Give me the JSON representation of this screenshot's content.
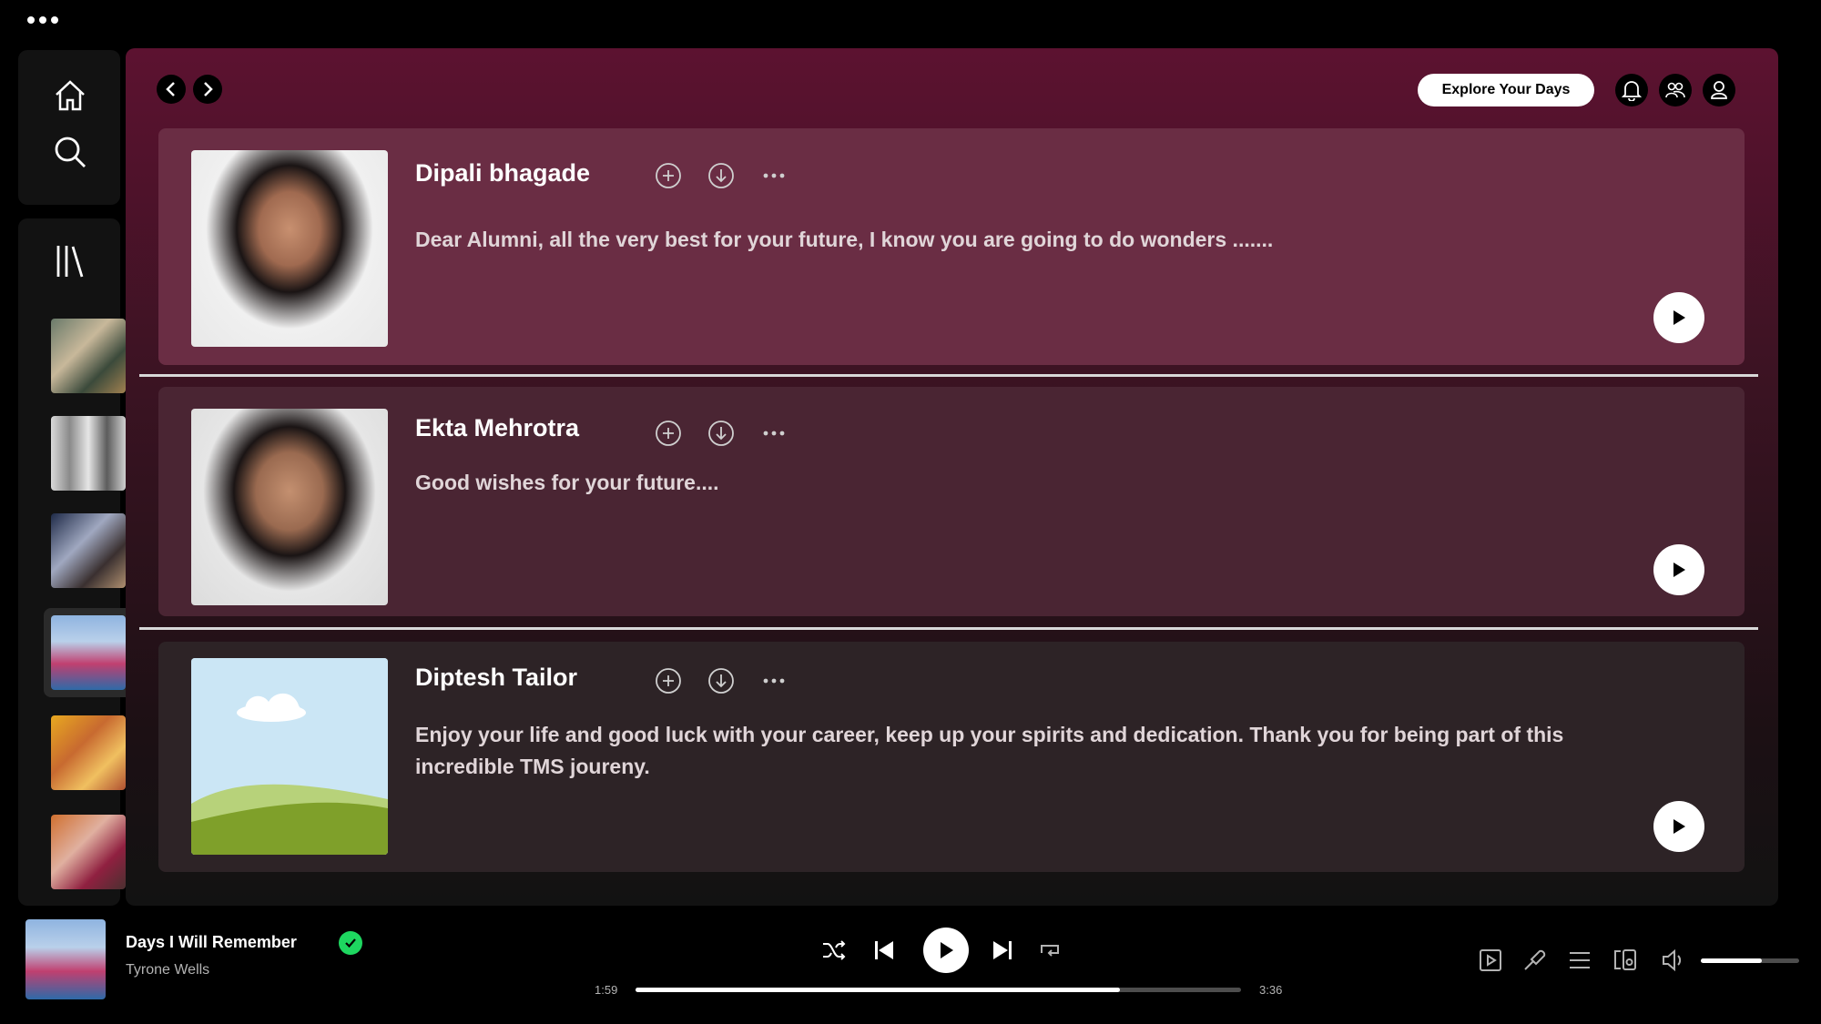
{
  "topbar": {
    "explore_label": "Explore Your Days"
  },
  "cards": [
    {
      "name": "Dipali bhagade",
      "message": "Dear Alumni, all the very best for your future, I know you are going to do wonders ......."
    },
    {
      "name": "Ekta Mehrotra",
      "message": "Good wishes for your future...."
    },
    {
      "name": "Diptesh Tailor",
      "message": "Enjoy your life and good luck with your career, keep up your spirits and dedication. Thank you for being part of this incredible TMS joureny."
    }
  ],
  "player": {
    "title": "Days I Will Remember",
    "artist": "Tyrone Wells",
    "elapsed": "1:59",
    "duration": "3:36",
    "progress_fraction": 0.8,
    "volume_fraction": 0.62
  },
  "colors": {
    "accent": "#1ed760",
    "card_1": "#6a2d44",
    "card_2": "#4a2533",
    "card_3": "#2d2326"
  },
  "icons": [
    "more-icon",
    "home-icon",
    "search-icon",
    "library-icon",
    "back-icon",
    "forward-icon",
    "bell-icon",
    "friends-icon",
    "profile-icon",
    "add-icon",
    "download-icon",
    "play-icon",
    "shuffle-icon",
    "previous-icon",
    "next-icon",
    "repeat-icon",
    "now-playing-view-icon",
    "mic-icon",
    "queue-icon",
    "devices-icon",
    "volume-icon",
    "check-icon"
  ]
}
